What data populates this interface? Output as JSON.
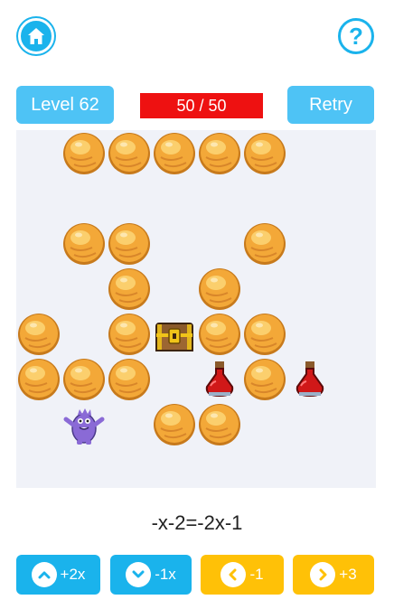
{
  "header": {
    "home_icon": "home-icon",
    "help_label": "?"
  },
  "toolbar": {
    "level_label": "Level 62",
    "progress_text": "50 / 50",
    "retry_label": "Retry"
  },
  "board": {
    "columns": 8,
    "rows": 8,
    "background": "#f0f2f8",
    "objects": [
      {
        "type": "rock",
        "col": 1,
        "row": 0
      },
      {
        "type": "rock",
        "col": 2,
        "row": 0
      },
      {
        "type": "rock",
        "col": 3,
        "row": 0
      },
      {
        "type": "rock",
        "col": 4,
        "row": 0
      },
      {
        "type": "rock",
        "col": 5,
        "row": 0
      },
      {
        "type": "rock",
        "col": 1,
        "row": 2
      },
      {
        "type": "rock",
        "col": 2,
        "row": 2
      },
      {
        "type": "rock",
        "col": 5,
        "row": 2
      },
      {
        "type": "rock",
        "col": 2,
        "row": 3
      },
      {
        "type": "rock",
        "col": 4,
        "row": 3
      },
      {
        "type": "rock",
        "col": 0,
        "row": 4
      },
      {
        "type": "rock",
        "col": 2,
        "row": 4
      },
      {
        "type": "treasure-chest",
        "col": 3,
        "row": 4
      },
      {
        "type": "rock",
        "col": 4,
        "row": 4
      },
      {
        "type": "rock",
        "col": 5,
        "row": 4
      },
      {
        "type": "rock",
        "col": 0,
        "row": 5
      },
      {
        "type": "rock",
        "col": 1,
        "row": 5
      },
      {
        "type": "rock",
        "col": 2,
        "row": 5
      },
      {
        "type": "potion",
        "col": 4,
        "row": 5
      },
      {
        "type": "rock",
        "col": 5,
        "row": 5
      },
      {
        "type": "potion",
        "col": 6,
        "row": 5
      },
      {
        "type": "monster",
        "col": 1,
        "row": 6
      },
      {
        "type": "rock",
        "col": 3,
        "row": 6
      },
      {
        "type": "rock",
        "col": 4,
        "row": 6
      }
    ]
  },
  "equation": "-x-2=-2x-1",
  "controls": [
    {
      "id": "up",
      "icon": "chevron-up-icon",
      "label": "+2x",
      "color": "#1ab3ec"
    },
    {
      "id": "down",
      "icon": "chevron-down-icon",
      "label": "-1x",
      "color": "#1ab3ec"
    },
    {
      "id": "left",
      "icon": "chevron-left-icon",
      "label": "-1",
      "color": "#ffc107"
    },
    {
      "id": "right",
      "icon": "chevron-right-icon",
      "label": "+3",
      "color": "#ffc107"
    }
  ],
  "colors": {
    "accent_blue": "#1ab3ec",
    "accent_yellow": "#ffc107",
    "progress_red": "#ee1111"
  }
}
